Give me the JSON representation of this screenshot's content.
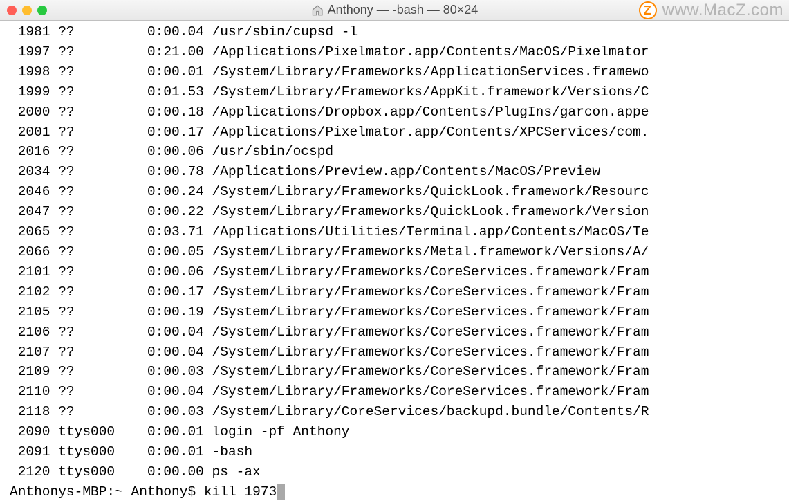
{
  "titlebar": {
    "title": "Anthony — -bash — 80×24",
    "home_icon": "home-icon"
  },
  "watermark": {
    "logo_letter": "Z",
    "text": "www.MacZ.com"
  },
  "terminal": {
    "rows": [
      {
        "pid": "1981",
        "tty": "??",
        "time": "0:00.04",
        "cmd": "/usr/sbin/cupsd -l"
      },
      {
        "pid": "1997",
        "tty": "??",
        "time": "0:21.00",
        "cmd": "/Applications/Pixelmator.app/Contents/MacOS/Pixelmator"
      },
      {
        "pid": "1998",
        "tty": "??",
        "time": "0:00.01",
        "cmd": "/System/Library/Frameworks/ApplicationServices.framewo"
      },
      {
        "pid": "1999",
        "tty": "??",
        "time": "0:01.53",
        "cmd": "/System/Library/Frameworks/AppKit.framework/Versions/C"
      },
      {
        "pid": "2000",
        "tty": "??",
        "time": "0:00.18",
        "cmd": "/Applications/Dropbox.app/Contents/PlugIns/garcon.appe"
      },
      {
        "pid": "2001",
        "tty": "??",
        "time": "0:00.17",
        "cmd": "/Applications/Pixelmator.app/Contents/XPCServices/com."
      },
      {
        "pid": "2016",
        "tty": "??",
        "time": "0:00.06",
        "cmd": "/usr/sbin/ocspd"
      },
      {
        "pid": "2034",
        "tty": "??",
        "time": "0:00.78",
        "cmd": "/Applications/Preview.app/Contents/MacOS/Preview"
      },
      {
        "pid": "2046",
        "tty": "??",
        "time": "0:00.24",
        "cmd": "/System/Library/Frameworks/QuickLook.framework/Resourc"
      },
      {
        "pid": "2047",
        "tty": "??",
        "time": "0:00.22",
        "cmd": "/System/Library/Frameworks/QuickLook.framework/Version"
      },
      {
        "pid": "2065",
        "tty": "??",
        "time": "0:03.71",
        "cmd": "/Applications/Utilities/Terminal.app/Contents/MacOS/Te"
      },
      {
        "pid": "2066",
        "tty": "??",
        "time": "0:00.05",
        "cmd": "/System/Library/Frameworks/Metal.framework/Versions/A/"
      },
      {
        "pid": "2101",
        "tty": "??",
        "time": "0:00.06",
        "cmd": "/System/Library/Frameworks/CoreServices.framework/Fram"
      },
      {
        "pid": "2102",
        "tty": "??",
        "time": "0:00.17",
        "cmd": "/System/Library/Frameworks/CoreServices.framework/Fram"
      },
      {
        "pid": "2105",
        "tty": "??",
        "time": "0:00.19",
        "cmd": "/System/Library/Frameworks/CoreServices.framework/Fram"
      },
      {
        "pid": "2106",
        "tty": "??",
        "time": "0:00.04",
        "cmd": "/System/Library/Frameworks/CoreServices.framework/Fram"
      },
      {
        "pid": "2107",
        "tty": "??",
        "time": "0:00.04",
        "cmd": "/System/Library/Frameworks/CoreServices.framework/Fram"
      },
      {
        "pid": "2109",
        "tty": "??",
        "time": "0:00.03",
        "cmd": "/System/Library/Frameworks/CoreServices.framework/Fram"
      },
      {
        "pid": "2110",
        "tty": "??",
        "time": "0:00.04",
        "cmd": "/System/Library/Frameworks/CoreServices.framework/Fram"
      },
      {
        "pid": "2118",
        "tty": "??",
        "time": "0:00.03",
        "cmd": "/System/Library/CoreServices/backupd.bundle/Contents/R"
      },
      {
        "pid": "2090",
        "tty": "ttys000",
        "time": "0:00.01",
        "cmd": "login -pf Anthony"
      },
      {
        "pid": "2091",
        "tty": "ttys000",
        "time": "0:00.01",
        "cmd": "-bash"
      },
      {
        "pid": "2120",
        "tty": "ttys000",
        "time": "0:00.00",
        "cmd": "ps -ax"
      }
    ],
    "prompt": "Anthonys-MBP:~ Anthony$ ",
    "command": "kill 1973"
  }
}
